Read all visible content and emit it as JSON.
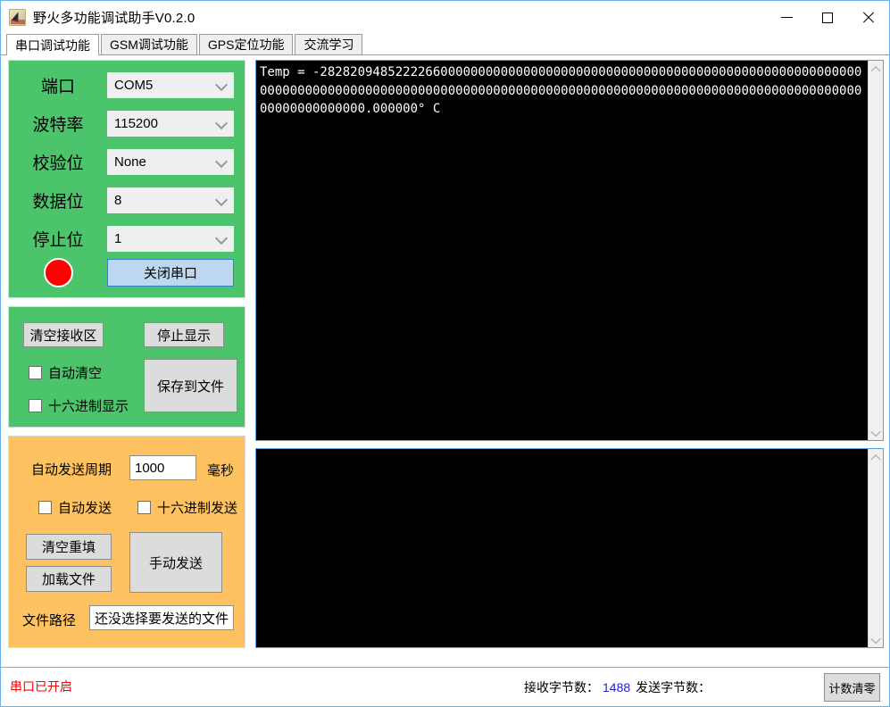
{
  "window": {
    "title": "野火多功能调试助手V0.2.0",
    "minimize_label": "最小化",
    "maximize_label": "最大化",
    "close_label": "关闭"
  },
  "tabs": [
    {
      "label": "串口调试功能",
      "active": true
    },
    {
      "label": "GSM调试功能",
      "active": false
    },
    {
      "label": "GPS定位功能",
      "active": false
    },
    {
      "label": "交流学习",
      "active": false
    }
  ],
  "serial_config": {
    "rows": [
      {
        "label": "端口",
        "value": "COM5"
      },
      {
        "label": "波特率",
        "value": "115200"
      },
      {
        "label": "校验位",
        "value": "None"
      },
      {
        "label": "数据位",
        "value": "8"
      },
      {
        "label": "停止位",
        "value": "1"
      }
    ],
    "led_state": "open",
    "led_color": "#FF0000",
    "toggle_button": "关闭串口"
  },
  "receive_controls": {
    "clear_button": "清空接收区",
    "stop_button": "停止显示",
    "save_button": "保存到文件",
    "auto_clear": {
      "label": "自动清空",
      "checked": false
    },
    "hex_display": {
      "label": "十六进制显示",
      "checked": false
    }
  },
  "send_controls": {
    "period_label": "自动发送周期",
    "period_value": "1000",
    "period_unit": "毫秒",
    "auto_send": {
      "label": "自动发送",
      "checked": false
    },
    "hex_send": {
      "label": "十六进制发送",
      "checked": false
    },
    "clear_refill_button": "清空重填",
    "load_file_button": "加载文件",
    "manual_send_button": "手动发送",
    "file_path_label": "文件路径",
    "file_path_value": "还没选择要发送的文件"
  },
  "receive_area": {
    "text": "Temp = -2828209485222266000000000000000000000000000000000000000000000000000000000000000000000000000000000000000000000000000000000000000000000000000000000000000000000000000000.000000° C"
  },
  "send_area": {
    "text": ""
  },
  "statusbar": {
    "port_status": "串口已开启",
    "recv_label": "接收字节数：",
    "recv_value": "1488",
    "send_label": "发送字节数：",
    "send_value": "",
    "reset_button": "计数清零"
  },
  "colors": {
    "config_panel": "#4BC46C",
    "send_panel": "#FFC260",
    "toggle_button": "#BCD7EF",
    "status_error": "#FF0000",
    "count_value": "#2222CC",
    "terminal_bg": "#000000"
  }
}
